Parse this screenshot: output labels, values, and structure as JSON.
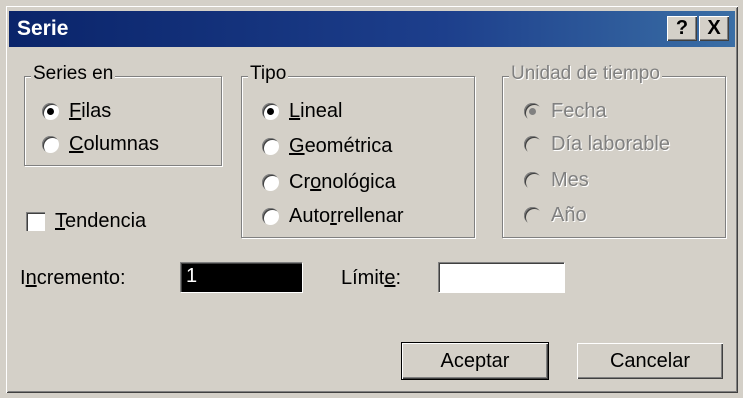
{
  "window": {
    "title": "Serie",
    "help_btn": "?",
    "close_btn": "X"
  },
  "series_en": {
    "legend": "Series en",
    "options": [
      {
        "pre": "",
        "key": "F",
        "post": "ilas",
        "checked": true
      },
      {
        "pre": "",
        "key": "C",
        "post": "olumnas",
        "checked": false
      }
    ]
  },
  "tipo": {
    "legend": "Tipo",
    "options": [
      {
        "pre": "",
        "key": "L",
        "post": "ineal",
        "checked": true
      },
      {
        "pre": "",
        "key": "G",
        "post": "eométrica",
        "checked": false
      },
      {
        "pre": "Cr",
        "key": "o",
        "post": "nológica",
        "checked": false
      },
      {
        "pre": "Auto",
        "key": "r",
        "post": "rellenar",
        "checked": false
      }
    ]
  },
  "unidad": {
    "legend": "Unidad de tiempo",
    "options": [
      {
        "label": "Fecha",
        "checked": true
      },
      {
        "label": "Día laborable",
        "checked": false
      },
      {
        "label": "Mes",
        "checked": false
      },
      {
        "label": "Año",
        "checked": false
      }
    ]
  },
  "tendencia": {
    "pre": "",
    "key": "T",
    "post": "endencia",
    "checked": false
  },
  "incremento": {
    "pre": "I",
    "key": "n",
    "post": "cremento:",
    "value": "1"
  },
  "limite": {
    "pre": "Límit",
    "key": "e",
    "post": ":",
    "value": ""
  },
  "buttons": {
    "accept": "Aceptar",
    "cancel": "Cancelar"
  }
}
